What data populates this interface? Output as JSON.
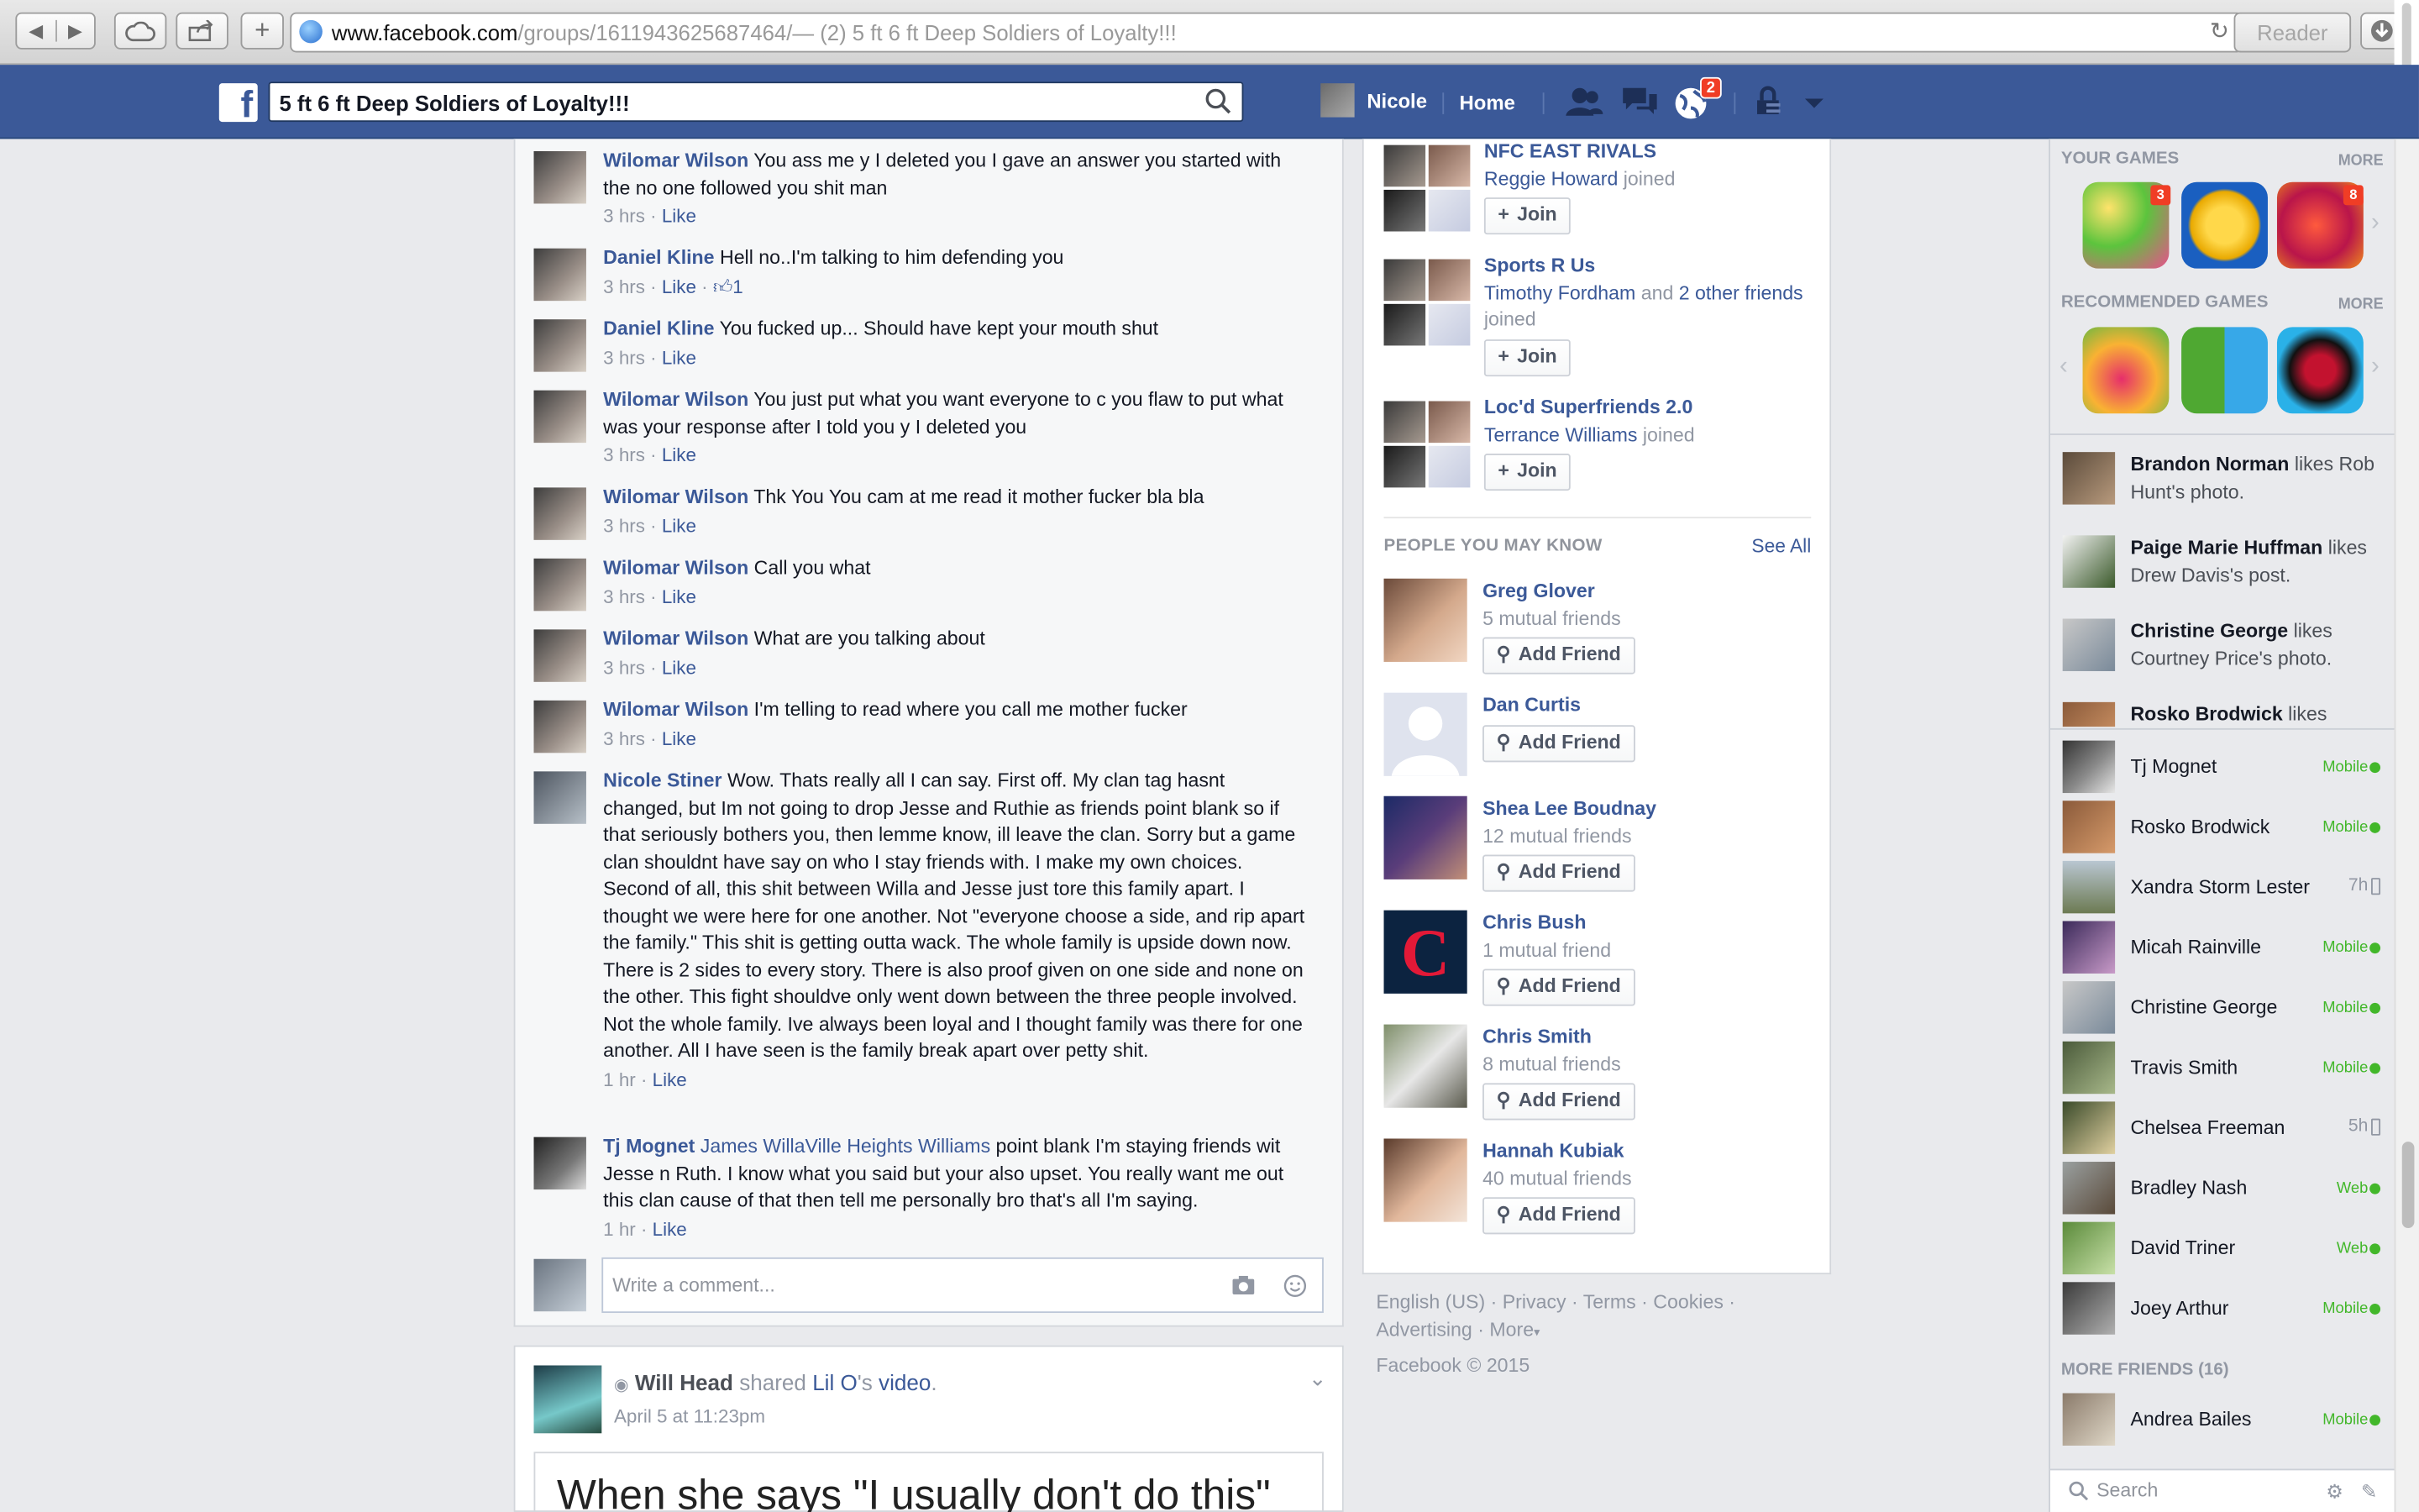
{
  "browser": {
    "url_host": "www.facebook.com",
    "url_path": "/groups/1611943625687464/",
    "page_title": " — (2) 5 ft 6 ft Deep Soldiers of Loyalty!!!",
    "reader_label": "Reader"
  },
  "topbar": {
    "search_value": "5 ft 6 ft Deep Soldiers of Loyalty!!!",
    "user_name": "Nicole",
    "home_label": "Home",
    "notification_count": "2"
  },
  "comments": [
    {
      "name": "Wilomar Wilson",
      "text": "You ass me y I deleted you I gave an answer you started with the no one followed you shit man",
      "time": "3 hrs",
      "like": "Like"
    },
    {
      "name": "Daniel Kline",
      "text": "Hell no..I'm talking to him defending you",
      "time": "3 hrs",
      "like": "Like",
      "likes": "1"
    },
    {
      "name": "Daniel Kline",
      "text": "You fucked up... Should have kept your mouth shut",
      "time": "3 hrs",
      "like": "Like"
    },
    {
      "name": "Wilomar Wilson",
      "text": "You just put what you want everyone to c you flaw to put what was your response after I told you y I deleted you",
      "time": "3 hrs",
      "like": "Like"
    },
    {
      "name": "Wilomar Wilson",
      "text": "Thk You You cam at me read it mother fucker bla bla",
      "time": "3 hrs",
      "like": "Like"
    },
    {
      "name": "Wilomar Wilson",
      "text": "Call you what",
      "time": "3 hrs",
      "like": "Like"
    },
    {
      "name": "Wilomar Wilson",
      "text": "What are you talking about",
      "time": "3 hrs",
      "like": "Like"
    },
    {
      "name": "Wilomar Wilson",
      "text": "I'm telling to read where you call me mother fucker",
      "time": "3 hrs",
      "like": "Like"
    },
    {
      "name": "Nicole Stiner",
      "text": "Wow. Thats really all I can say. First off. My clan tag hasnt changed, but Im not going to drop Jesse and Ruthie as friends point blank so if that seriously bothers you, then lemme know, ill leave the clan. Sorry but a game clan shouldnt have say on who I stay friends with. I make my own choices. Second of all, this shit between Willa and Jesse just tore this family apart. I thought we were here for one another. Not \"everyone choose a side, and rip apart the family.\" This shit is getting outta wack. The whole family is upside down now. There is 2 sides to every story. There is also proof given on one side and none on the other. This fight shouldve only went down between the three people involved. Not the whole family. Ive always been loyal and I thought family was there for one another. All I have seen is the family break apart over petty shit.",
      "time": "1 hr",
      "like": "Like"
    },
    {
      "name": "Tj Mognet",
      "tag": "James WillaVille Heights Williams",
      "text": "point blank I'm staying friends wit Jesse n Ruth. I know what you said but your also upset. You really want me out this clan cause of that then tell me personally bro that's all I'm saying.",
      "time": "1 hr",
      "like": "Like"
    }
  ],
  "comment_box": {
    "placeholder": "Write a comment..."
  },
  "next_post": {
    "author": "Will Head",
    "verb": "shared",
    "page": "Lil O",
    "possessive": "'s",
    "object": "video",
    "date": "April 5 at 11:23pm",
    "video_text": "When she says \"I usually don't do this\""
  },
  "groups": [
    {
      "name": "NFC EAST RIVALS",
      "member": "Reggie Howard",
      "others": "",
      "suffix": "joined",
      "button": "Join"
    },
    {
      "name": "Sports R Us",
      "member": "Timothy Fordham",
      "others": "2 other friends",
      "suffix": "joined",
      "button": "Join"
    },
    {
      "name": "Loc'd Superfriends 2.0",
      "member": "Terrance Williams",
      "others": "",
      "suffix": "joined",
      "button": "Join"
    }
  ],
  "pymk": {
    "heading": "PEOPLE YOU MAY KNOW",
    "see_all": "See All",
    "people": [
      {
        "name": "Greg Glover",
        "mutual": "5 mutual friends",
        "button": "Add Friend"
      },
      {
        "name": "Dan Curtis",
        "mutual": "",
        "button": "Add Friend"
      },
      {
        "name": "Shea Lee Boudnay",
        "mutual": "12 mutual friends",
        "button": "Add Friend"
      },
      {
        "name": "Chris Bush",
        "mutual": "1 mutual friend",
        "button": "Add Friend"
      },
      {
        "name": "Chris Smith",
        "mutual": "8 mutual friends",
        "button": "Add Friend"
      },
      {
        "name": "Hannah Kubiak",
        "mutual": "40 mutual friends",
        "button": "Add Friend"
      }
    ]
  },
  "footer": {
    "links": [
      "English (US)",
      "Privacy",
      "Terms",
      "Cookies",
      "Advertising",
      "More"
    ],
    "copyright": "Facebook © 2015"
  },
  "sidebar": {
    "your_games": "YOUR GAMES",
    "recommended_games": "RECOMMENDED GAMES",
    "more": "MORE",
    "game_badges": [
      "3",
      "8"
    ],
    "ticker": [
      {
        "name": "Brandon Norman",
        "verb": "likes",
        "object": "Rob Hunt's photo."
      },
      {
        "name": "Paige Marie Huffman",
        "verb": "likes",
        "object": "Drew Davis's post."
      },
      {
        "name": "Christine George",
        "verb": "likes",
        "object": "Courtney Price's photo."
      },
      {
        "name": "Rosko Brodwick",
        "verb": "likes",
        "object": ""
      }
    ],
    "chat": [
      {
        "name": "Tj Mognet",
        "status": "Mobile"
      },
      {
        "name": "Rosko Brodwick",
        "status": "Mobile"
      },
      {
        "name": "Xandra Storm Lester",
        "status": "7h"
      },
      {
        "name": "Micah Rainville",
        "status": "Mobile"
      },
      {
        "name": "Christine George",
        "status": "Mobile"
      },
      {
        "name": "Travis Smith",
        "status": "Mobile"
      },
      {
        "name": "Chelsea Freeman",
        "status": "5h"
      },
      {
        "name": "Bradley Nash",
        "status": "Web"
      },
      {
        "name": "David Triner",
        "status": "Web"
      },
      {
        "name": "Joey Arthur",
        "status": "Mobile"
      }
    ],
    "more_friends": "MORE FRIENDS (16)",
    "more_chat": [
      {
        "name": "Andrea Bailes",
        "status": "Mobile"
      }
    ],
    "search_placeholder": "Search"
  }
}
